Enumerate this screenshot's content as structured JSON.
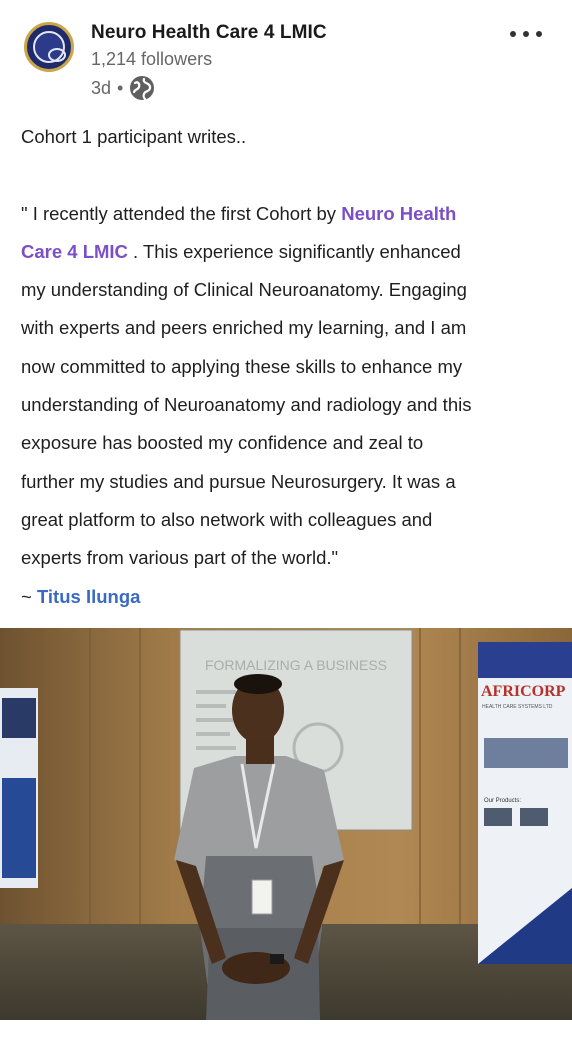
{
  "post": {
    "author": {
      "name": "Neuro Health Care 4 LMIC",
      "followers": "1,214 followers",
      "time": "3d",
      "separator": "•",
      "visibility_icon": "globe-icon"
    },
    "menu_icon": "more-horizontal-icon",
    "text": {
      "intro": "Cohort 1 participant writes..",
      "quote_lines": [
        {
          "before": "\" I recently attended the first Cohort by ",
          "mention": "Neuro Health"
        },
        {
          "mention": "Care 4 LMIC",
          "after": " . This experience significantly enhanced"
        },
        {
          "text": "my understanding of Clinical Neuroanatomy. Engaging"
        },
        {
          "text": "with experts and peers enriched my learning, and I am"
        },
        {
          "text": "now committed to applying these skills to enhance my"
        },
        {
          "text": "understanding of Neuroanatomy and radiology and this"
        },
        {
          "text": "exposure has boosted my confidence and zeal to"
        },
        {
          "text": "further my studies and pursue Neurosurgery. It was a"
        },
        {
          "text": "great platform to also network with colleagues and"
        },
        {
          "text": "experts from various part of the world.\""
        }
      ],
      "signature_prefix": "~ ",
      "signature_name": "Titus Ilunga"
    },
    "image": {
      "screen_title": "FORMALIZING A BUSINESS",
      "banner_brand": "AFRICORP",
      "banner_subtitle": "HEALTH CARE SYSTEMS LTD",
      "banner_products": "Our Products:"
    }
  },
  "colors": {
    "mention": "#7b4fc7",
    "author_link": "#3b69c6",
    "secondary_text": "#666666"
  }
}
